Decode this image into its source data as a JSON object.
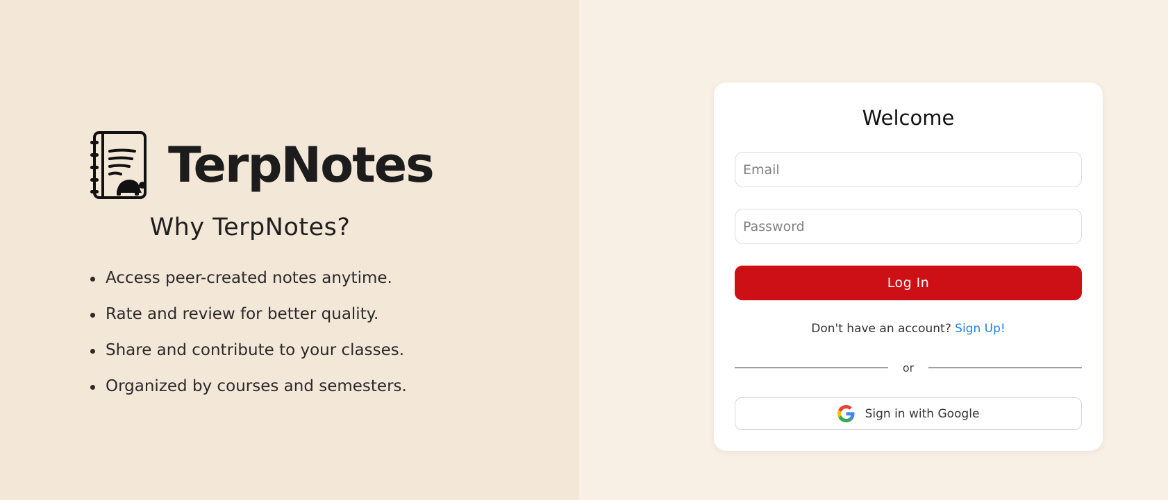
{
  "brand": {
    "name": "TerpNotes",
    "tagline_heading": "Why TerpNotes?",
    "features": [
      "Access peer-created notes anytime.",
      "Rate and review for better quality.",
      "Share and contribute to your classes.",
      "Organized by courses and semesters."
    ],
    "logo_icon": "notebook-turtle-icon"
  },
  "login": {
    "title": "Welcome",
    "email_placeholder": "Email",
    "email_value": "",
    "password_placeholder": "Password",
    "password_value": "",
    "login_label": "Log In",
    "signup_prompt": "Don't have an account?",
    "signup_link": "Sign Up!",
    "divider_text": "or",
    "google_label": "Sign in with Google",
    "google_icon": "google-icon"
  },
  "colors": {
    "left_bg": "#f3e7d8",
    "right_bg": "#f9f0e5",
    "primary": "#cc1016",
    "link": "#1f7ef0"
  }
}
